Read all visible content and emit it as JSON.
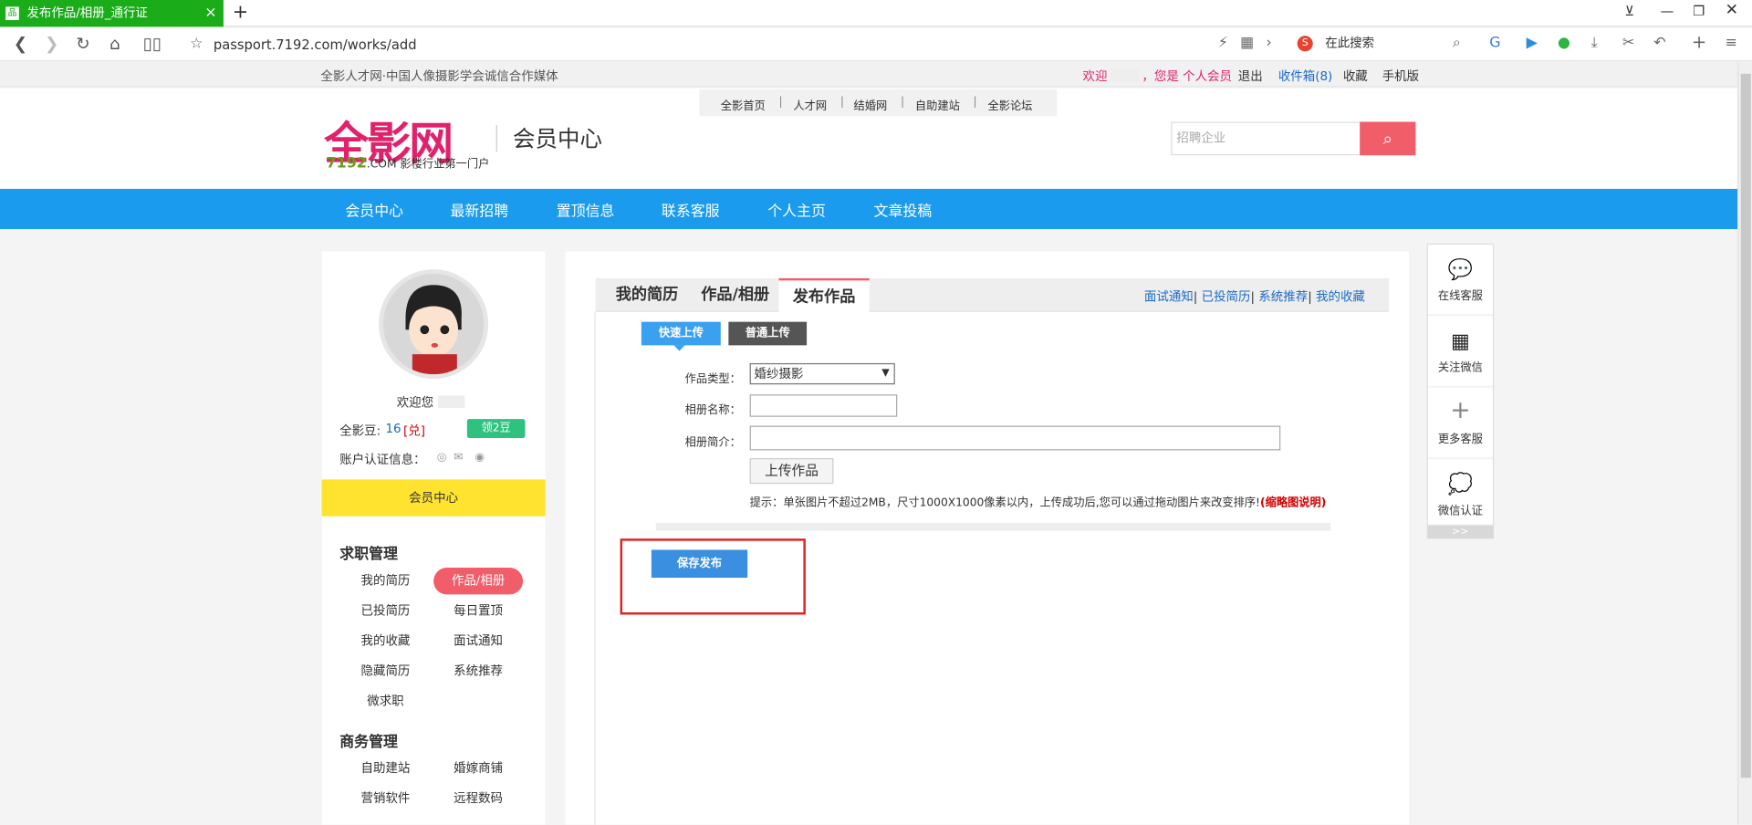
{
  "browser": {
    "tab_title": "发布作品/相册_通行证",
    "url": "passport.7192.com/works/add",
    "search_placeholder": "在此搜索"
  },
  "topbar": {
    "left_text": "全影人才网·中国人像摄影学会诚信合作媒体",
    "welcome": "欢迎",
    "member_text": "，您是 个人会员",
    "logout": "退出",
    "inbox": "收件箱(8)",
    "favorite": "收藏",
    "mobile": "手机版"
  },
  "quicknav": [
    "全影首页",
    "人才网",
    "结婚网",
    "自助建站",
    "全影论坛"
  ],
  "logo": {
    "text": "全影网",
    "sub_num": "7192",
    "sub_text": ".COM 影楼行业第一门户"
  },
  "header": {
    "member_center": "会员中心",
    "search_placeholder": "招聘企业"
  },
  "bluenav": [
    "会员中心",
    "最新招聘",
    "置顶信息",
    "联系客服",
    "个人主页",
    "文章投稿"
  ],
  "left": {
    "welcome": "欢迎您",
    "beans_label": "全影豆:",
    "beans_value": "16",
    "redeem": "[兑]",
    "get_beans": "领2豆",
    "cert_label": "账户认证信息：",
    "yellow_label": "会员中心",
    "job_section": "求职管理",
    "job_items": [
      "我的简历",
      "作品/相册",
      "已投简历",
      "每日置顶",
      "我的收藏",
      "面试通知",
      "隐藏简历",
      "系统推荐",
      "微求职"
    ],
    "biz_section": "商务管理",
    "biz_items": [
      "自助建站",
      "婚嫁商铺",
      "营销软件",
      "远程数码"
    ]
  },
  "main": {
    "tabs": [
      "我的简历",
      "作品/相册",
      "发布作品"
    ],
    "right_links": [
      "面试通知",
      "已投简历",
      "系统推荐",
      "我的收藏"
    ],
    "quick_upload": "快速上传",
    "normal_upload": "普通上传",
    "type_label": "作品类型：",
    "type_value": "婚纱摄影",
    "album_name_label": "相册名称：",
    "album_desc_label": "相册简介：",
    "upload_btn": "上传作品",
    "hint_prefix": "提示：",
    "hint_text": "单张图片不超过2MB，尺寸1000X1000像素以内，上传成功后,您可以通过拖动图片来改变排序!",
    "hint_link": "(缩略图说明)",
    "save_btn": "保存发布"
  },
  "rightfloat": [
    "在线客服",
    "关注微信",
    "更多客服",
    "微信认证"
  ],
  "rightfloat_more": ">>"
}
